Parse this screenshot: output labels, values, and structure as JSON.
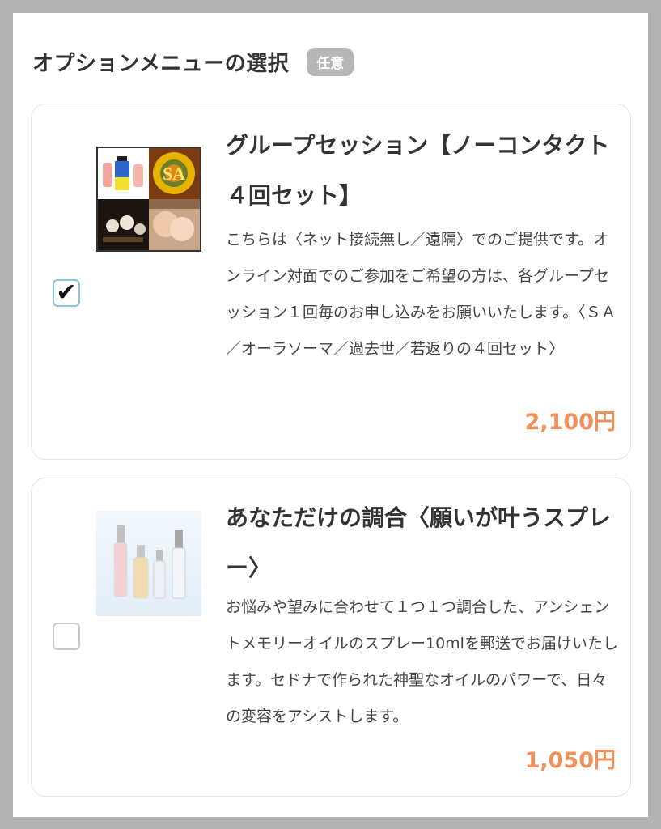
{
  "section": {
    "title": "オプションメニューの選択",
    "badge": "任意"
  },
  "options": [
    {
      "checked": true,
      "checkmark": "✔",
      "title": "グループセッション【ノーコンタクト４回セット】",
      "description": "こちらは〈ネット接続無し／遠隔〉でのご提供です。オンライン対面でのご参加をご希望の方は、各グループセッション１回毎のお申し込みをお願いいたします。〈ＳＡ／オーラソーマ／過去世／若返りの４回セット〉",
      "price": "2,100円",
      "thumb_text": "SA"
    },
    {
      "checked": false,
      "checkmark": "",
      "title": "あなただけの調合〈願いが叶うスプレー〉",
      "description": "お悩みや望みに合わせて１つ１つ調合した、アンシェントメモリーオイルのスプレー10mlを郵送でお届けいたします。セドナで作られた神聖なオイルのパワーで、日々の変容をアシストします。",
      "price": "1,050円"
    }
  ],
  "colors": {
    "price": "#f0915c",
    "badge_bg": "#b7b7b7",
    "frame": "#b3b3b3"
  }
}
